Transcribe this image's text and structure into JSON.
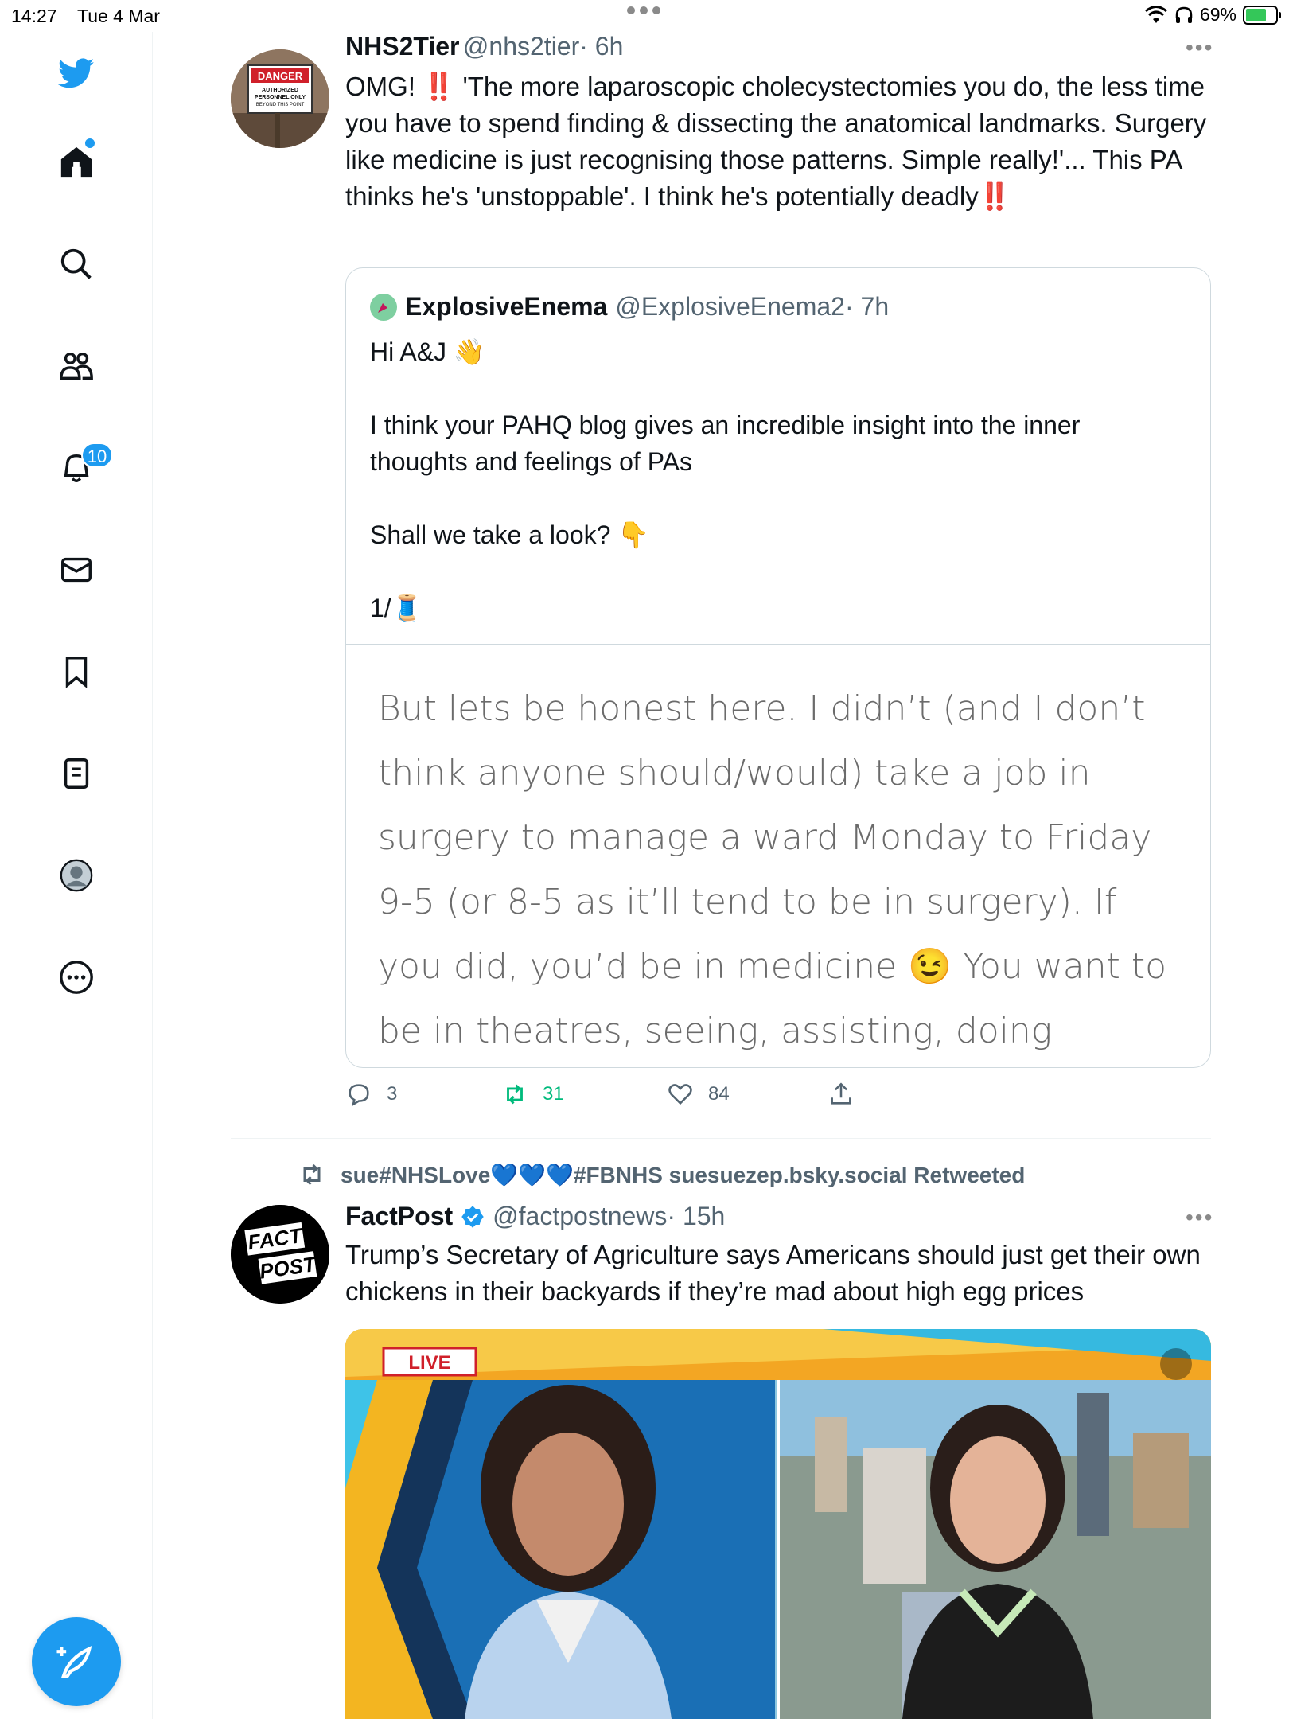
{
  "status_bar": {
    "time": "14:27",
    "date": "Tue 4 Mar",
    "battery": "69%",
    "battery_level": 0.69
  },
  "sidebar": {
    "icons": [
      "twitter-bird-icon",
      "home-icon",
      "search-icon",
      "communities-icon",
      "notifications-icon",
      "messages-icon",
      "bookmarks-icon",
      "lists-icon",
      "profile-icon",
      "more-icon"
    ],
    "notifications_badge": "10",
    "compose_icon": "compose-icon"
  },
  "tweet1": {
    "name": "NHS2Tier",
    "handle": "@nhs2tier",
    "time": "· 6h",
    "text_1": "OMG! ",
    "excl": "‼️",
    "text_2": "'The more laparoscopic cholecystectomies you do, the less time you have to spend finding & dissecting the anatomical landmarks. Surgery like medicine is just recognising those patterns. Simple really!'... This PA thinks he's 'unstoppable'. I think he's potentially deadly",
    "avatar_sign": {
      "title": "DANGER",
      "line1": "AUTHORIZED",
      "line2": "PERSONNEL ONLY",
      "line3": "BEYOND THIS POINT"
    },
    "quote": {
      "name": "ExplosiveEnema",
      "handle": "@ExplosiveEnema2",
      "time": "· 7h",
      "para1": "Hi A&J 👋",
      "para2": "I think your PAHQ blog gives an incredible insight into the inner thoughts and feelings of PAs",
      "para3": "Shall we take a look? 👇",
      "para4": "1/🧵",
      "image_text": "But lets be honest here. I didn’t (and I don’t think anyone should/would) take a job in surgery to manage a ward Monday to Friday 9-5 (or 8-5 as it’ll tend to be in surgery). If you did, you’d be in medicine 😉 You want to be in theatres, seeing, assisting, doing surgery? Am I right?"
    },
    "actions": {
      "replies": "3",
      "retweets": "31",
      "likes": "84"
    }
  },
  "tweet2": {
    "retweeted_by": "sue#NHSLove💙💙💙#FBNHS suesuezep.bsky.social Retweeted",
    "name": "FactPost",
    "handle": "@factpostnews",
    "time": "· 15h",
    "text": "Trump’s Secretary of Agriculture says Americans should just get their own chickens in their backyards if they’re mad about high egg prices",
    "avatar_line1": "FACT",
    "avatar_line2": "POST",
    "media_badge": "LIVE"
  },
  "colors": {
    "accent": "#1d9bf0",
    "retweet_green": "#00ba7c",
    "text": "#0f1419",
    "secondary": "#536471"
  }
}
